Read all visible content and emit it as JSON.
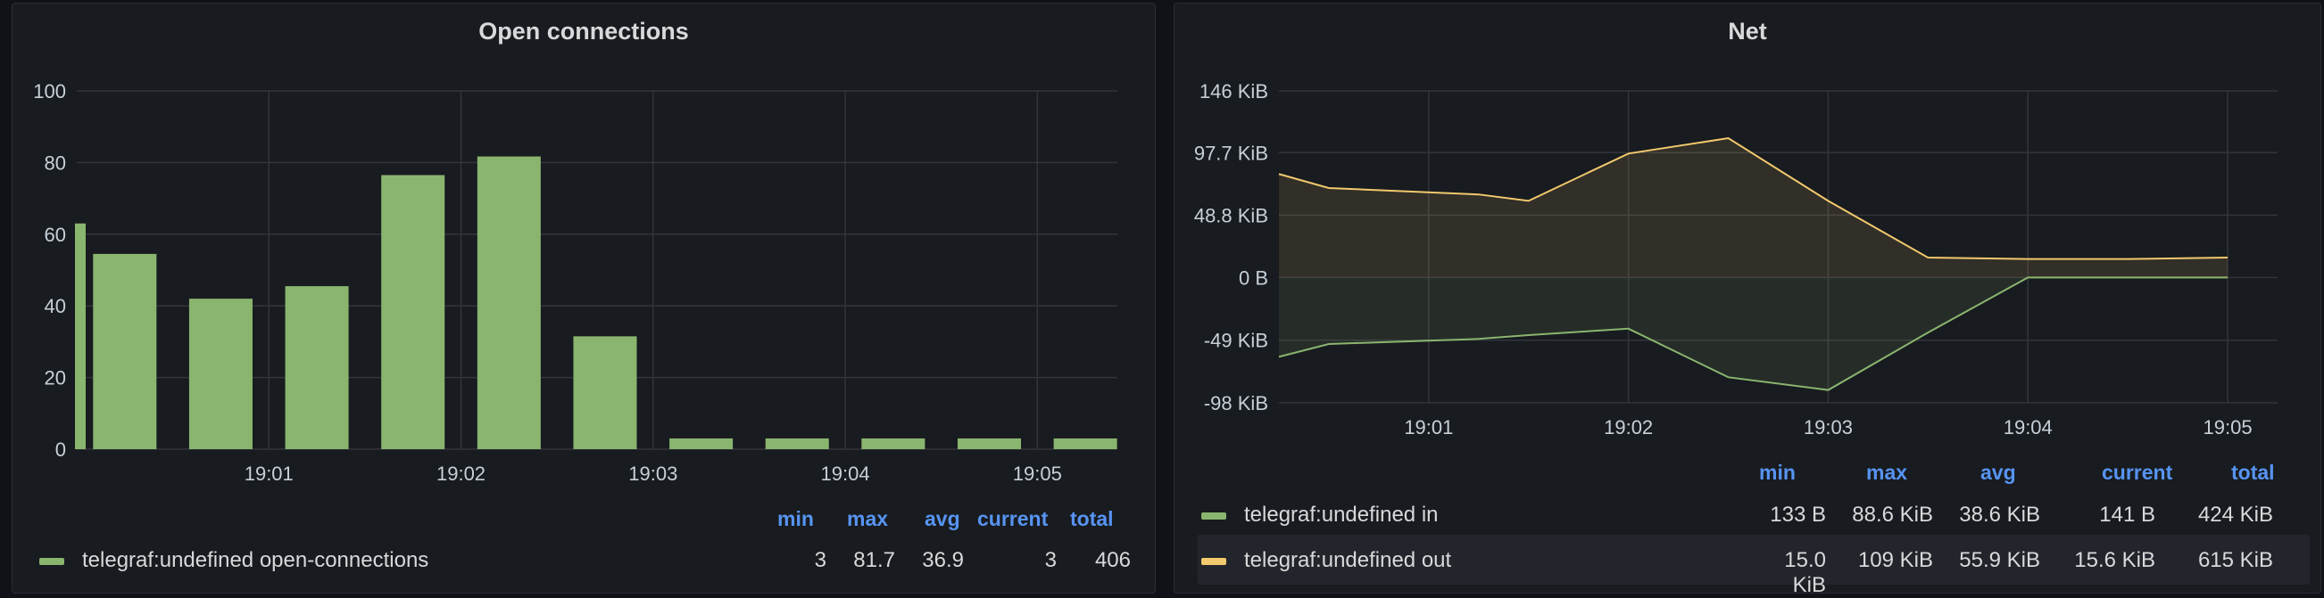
{
  "chart_data": [
    {
      "type": "bar",
      "title": "Open connections",
      "x_ticks": [
        "19:01",
        "19:02",
        "19:03",
        "19:04",
        "19:05"
      ],
      "y_ticks": [
        "100",
        "80",
        "60",
        "40",
        "20",
        "0"
      ],
      "ylim": [
        0,
        100
      ],
      "grid": true,
      "legend_position": "bottom",
      "series": [
        {
          "name": "telegraf:undefined open-connections",
          "color": "#8ab56f",
          "times": [
            "19:00:00",
            "19:00:15",
            "19:00:45",
            "19:01:15",
            "19:01:45",
            "19:02:15",
            "19:02:45",
            "19:03:15",
            "19:03:45",
            "19:04:15",
            "19:04:45",
            "19:05:15"
          ],
          "values": [
            63,
            54.5,
            42,
            45.5,
            76.5,
            81.7,
            31.5,
            3,
            3,
            3,
            3,
            3
          ]
        }
      ],
      "legend": {
        "columns": [
          "min",
          "max",
          "avg",
          "current",
          "total"
        ],
        "rows": [
          {
            "name": "telegraf:undefined open-connections",
            "min": "3",
            "max": "81.7",
            "avg": "36.9",
            "current": "3",
            "total": "406"
          }
        ]
      }
    },
    {
      "type": "area",
      "title": "Net",
      "x_ticks": [
        "19:01",
        "19:02",
        "19:03",
        "19:04",
        "19:05"
      ],
      "y_ticks": [
        "146 KiB",
        "97.7 KiB",
        "48.8 KiB",
        "0 B",
        "-49 KiB",
        "-98 KiB"
      ],
      "ylim_kib": [
        -98,
        146
      ],
      "grid": true,
      "legend_position": "bottom",
      "series": [
        {
          "name": "telegraf:undefined in",
          "color": "#8ab56f",
          "times": [
            "19:00:15",
            "19:00:30",
            "19:01:15",
            "19:01:30",
            "19:02:00",
            "19:02:30",
            "19:03:00",
            "19:03:30",
            "19:04:00",
            "19:04:30",
            "19:05:00"
          ],
          "values_kib": [
            -62,
            -52,
            -48,
            -45,
            -40,
            -78,
            -88,
            -43,
            0,
            0,
            0
          ]
        },
        {
          "name": "telegraf:undefined out",
          "color": "#f2c96d",
          "times": [
            "19:00:15",
            "19:00:30",
            "19:01:15",
            "19:01:30",
            "19:02:00",
            "19:02:30",
            "19:03:00",
            "19:03:30",
            "19:04:00",
            "19:04:30",
            "19:05:00"
          ],
          "values_kib": [
            81,
            70,
            65,
            60,
            97,
            109,
            60,
            15.6,
            14.5,
            14.5,
            15.6
          ]
        }
      ],
      "legend": {
        "columns": [
          "min",
          "max",
          "avg",
          "current",
          "total"
        ],
        "rows": [
          {
            "name": "telegraf:undefined in",
            "min": "133 B",
            "max": "88.6 KiB",
            "avg": "38.6 KiB",
            "current": "141 B",
            "total": "424 KiB"
          },
          {
            "name": "telegraf:undefined out",
            "min": "15.0 KiB",
            "max": "109 KiB",
            "avg": "55.9 KiB",
            "current": "15.6 KiB",
            "total": "615 KiB"
          }
        ]
      }
    }
  ]
}
